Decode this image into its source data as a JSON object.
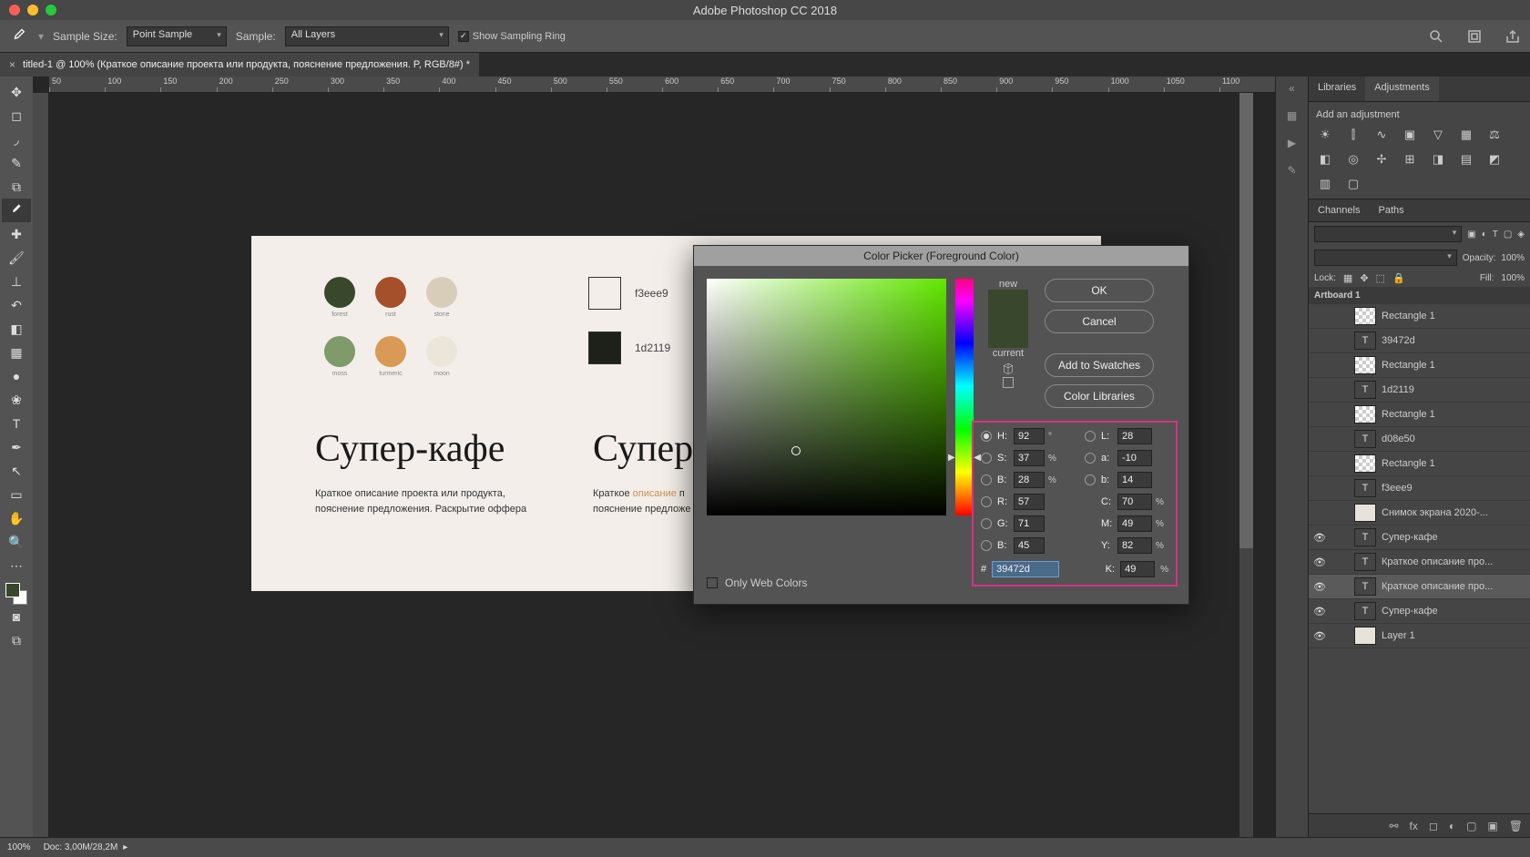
{
  "app_title": "Adobe Photoshop CC 2018",
  "options": {
    "sample_size_label": "Sample Size:",
    "sample_size_value": "Point Sample",
    "sample_label": "Sample:",
    "sample_value": "All Layers",
    "show_ring": "Show Sampling Ring"
  },
  "doc_tab": "titled-1 @ 100% (Краткое описание проекта или продукта, пояснение предложения. P, RGB/8#) *",
  "ruler_marks": [
    "50",
    "100",
    "150",
    "200",
    "250",
    "300",
    "350",
    "400",
    "450",
    "500",
    "550",
    "600",
    "650",
    "700",
    "750",
    "800",
    "850",
    "900",
    "950",
    "1000",
    "1050",
    "1100"
  ],
  "canvas": {
    "palette": [
      [
        {
          "c": "#39472d",
          "l": "forest"
        },
        {
          "c": "#a5502a",
          "l": "rust"
        },
        {
          "c": "#d8cdb8",
          "l": "stone"
        }
      ],
      [
        {
          "c": "#7f9a6b",
          "l": "moss"
        },
        {
          "c": "#d99a55",
          "l": "turmeric"
        },
        {
          "c": "#ece6da",
          "l": "moon"
        }
      ]
    ],
    "swatches": [
      {
        "c": "#f3eee9",
        "h": "f3eee9"
      },
      {
        "c": "#1d2119",
        "h": "1d2119"
      }
    ],
    "h1": "Супер-кафе",
    "h2": "Супер",
    "p1a": "Краткое описание проекта или продукта,",
    "p1b": "пояснение предложения. Раскрытие оффера",
    "p2a": "Краткое ",
    "p2hl": "описание",
    "p2b": " п",
    "p2c": "пояснение предложе"
  },
  "adjustments": {
    "tabs": [
      "Libraries",
      "Adjustments"
    ],
    "label": "Add an adjustment"
  },
  "layers_tabs": [
    "Channels",
    "Paths"
  ],
  "opacity_label": "Opacity:",
  "opacity_val": "100%",
  "fill_label": "Fill:",
  "fill_val": "100%",
  "lock_label": "Lock:",
  "artboard": "Artboard 1",
  "layers": [
    {
      "eye": "blank",
      "type": "rect",
      "name": "Rectangle 1"
    },
    {
      "eye": "blank",
      "type": "txt",
      "name": "39472d"
    },
    {
      "eye": "blank",
      "type": "rect",
      "name": "Rectangle 1"
    },
    {
      "eye": "blank",
      "type": "txt",
      "name": "1d2119"
    },
    {
      "eye": "blank",
      "type": "rect",
      "name": "Rectangle 1"
    },
    {
      "eye": "blank",
      "type": "txt",
      "name": "d08e50"
    },
    {
      "eye": "blank",
      "type": "rect",
      "name": "Rectangle 1"
    },
    {
      "eye": "blank",
      "type": "txt",
      "name": "f3eee9"
    },
    {
      "eye": "blank",
      "type": "img",
      "name": "Снимок экрана 2020-..."
    },
    {
      "eye": "on",
      "type": "txt",
      "name": "Супер-кафе"
    },
    {
      "eye": "on",
      "type": "txt",
      "name": "Краткое описание про..."
    },
    {
      "eye": "on",
      "type": "txt",
      "name": "Краткое описание про...",
      "sel": true
    },
    {
      "eye": "on",
      "type": "txt",
      "name": "Супер-кафе"
    },
    {
      "eye": "on",
      "type": "img",
      "name": "Layer 1"
    }
  ],
  "picker": {
    "title": "Color Picker (Foreground Color)",
    "new": "new",
    "current": "current",
    "new_c": "#39472d",
    "cur_c": "#39472d",
    "ok": "OK",
    "cancel": "Cancel",
    "add": "Add to Swatches",
    "lib": "Color Libraries",
    "web": "Only Web Colors",
    "H": "92",
    "S": "37",
    "Bv": "28",
    "L": "28",
    "a": "-10",
    "b": "14",
    "R": "57",
    "G": "71",
    "Bb": "45",
    "C": "70",
    "M": "49",
    "Y": "82",
    "K": "49",
    "hex": "39472d"
  },
  "status": {
    "zoom": "100%",
    "doc": "Doc: 3,00M/28,2M"
  }
}
